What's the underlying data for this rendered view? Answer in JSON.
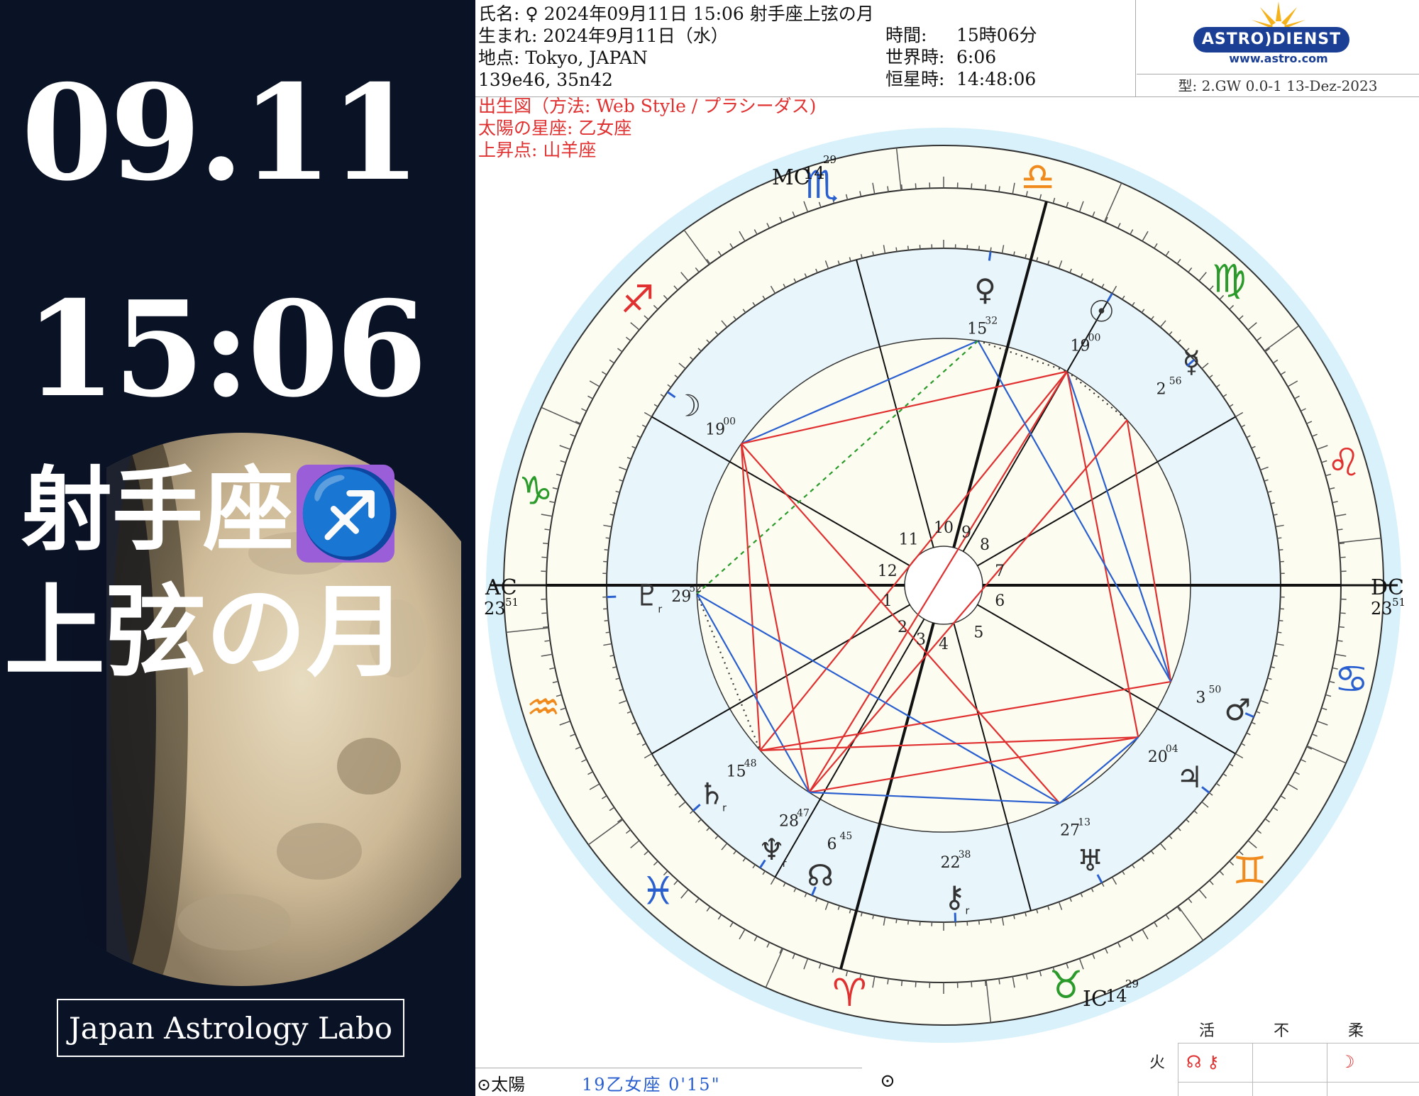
{
  "left_panel": {
    "date": "09.11",
    "time": "15:06",
    "sign_text": "射手座",
    "sign_emoji": "♐",
    "phase_text": "上弦の月",
    "brand": "Japan Astrology Labo"
  },
  "header": {
    "name_line": "氏名: ♀ 2024年09月11日 15:06 射手座上弦の月",
    "birth_line": "生まれ: 2024年9月11日（水）",
    "place_line": "地点:  Tokyo, JAPAN",
    "coords_line": "139e46, 35n42",
    "time_label": "時間:",
    "time_value": "15時06分",
    "ut_label": "世界時:",
    "ut_value": "6:06",
    "st_label": "恒星時:",
    "st_value": "14:48:06",
    "logo_text": "ASTRO)DIENST",
    "logo_url": "www.astro.com",
    "model_text": "型: 2.GW   0.0-1   13-Dez-2023"
  },
  "chart_info": {
    "method_line": "出生図（方法: Web Style / プラシーダス)",
    "sun_sign_line": "太陽の星座: 乙女座",
    "asc_line": "上昇点: 山羊座"
  },
  "wheel": {
    "angles": {
      "ac": "AC",
      "ac_deg": "23",
      "ac_min": "51",
      "dc": "DC",
      "dc_deg": "23",
      "dc_min": "51",
      "mc": "MC",
      "mc_deg": "14",
      "mc_min": "29",
      "ic": "IC",
      "ic_deg": "14",
      "ic_min": "29"
    },
    "houses": [
      "1",
      "2",
      "3",
      "4",
      "5",
      "6",
      "7",
      "8",
      "9",
      "10",
      "11",
      "12"
    ],
    "signs": [
      {
        "glyph": "♎",
        "name": "libra",
        "color": "#f08a1c"
      },
      {
        "glyph": "♍",
        "name": "virgo",
        "color": "#2a9a2a"
      },
      {
        "glyph": "♌",
        "name": "leo",
        "color": "#e03030"
      },
      {
        "glyph": "♋",
        "name": "cancer",
        "color": "#2a5fd0"
      },
      {
        "glyph": "♊",
        "name": "gemini",
        "color": "#f08a1c"
      },
      {
        "glyph": "♉",
        "name": "taurus",
        "color": "#2a9a2a"
      },
      {
        "glyph": "♈",
        "name": "aries",
        "color": "#e03030"
      },
      {
        "glyph": "♓",
        "name": "pisces",
        "color": "#2a5fd0"
      },
      {
        "glyph": "♒",
        "name": "aquarius",
        "color": "#f08a1c"
      },
      {
        "glyph": "♑",
        "name": "capricorn",
        "color": "#2a9a2a"
      },
      {
        "glyph": "♐",
        "name": "sagittarius",
        "color": "#e03030"
      },
      {
        "glyph": "♏",
        "name": "scorpio",
        "color": "#2a5fd0"
      }
    ],
    "planets": [
      {
        "name": "venus",
        "glyph": "♀",
        "deg": "15",
        "min": "32"
      },
      {
        "name": "sun",
        "glyph": "☉",
        "deg": "19",
        "min": "00"
      },
      {
        "name": "mercury",
        "glyph": "☿",
        "deg": "2",
        "min": "56"
      },
      {
        "name": "moon",
        "glyph": "☽",
        "deg": "19",
        "min": "00"
      },
      {
        "name": "pluto",
        "glyph": "♇",
        "deg": "29",
        "min": "52",
        "retro": "r"
      },
      {
        "name": "mars",
        "glyph": "♂",
        "deg": "3",
        "min": "50"
      },
      {
        "name": "jupiter",
        "glyph": "♃",
        "deg": "20",
        "min": "04"
      },
      {
        "name": "uranus",
        "glyph": "♅",
        "deg": "27",
        "min": "13"
      },
      {
        "name": "chiron",
        "glyph": "⚷",
        "deg": "22",
        "min": "38",
        "retro": "r"
      },
      {
        "name": "node",
        "glyph": "☊",
        "deg": "6",
        "min": "45"
      },
      {
        "name": "neptune",
        "glyph": "♆",
        "deg": "28",
        "min": "47",
        "retro": "r"
      },
      {
        "name": "saturn",
        "glyph": "♄",
        "deg": "15",
        "min": "48",
        "retro": "r"
      }
    ]
  },
  "bottom": {
    "planet_label": "⊙太陽",
    "planet_value": "19乙女座  0'15\"",
    "symbol": "⊙"
  },
  "elements_table": {
    "headers": [
      "活",
      "不",
      "柔"
    ],
    "row_label": "火",
    "cell1": "☊ ⚷",
    "cell3": "☽"
  },
  "colors": {
    "aspect_red": "#e03030",
    "aspect_blue": "#2a5fd0",
    "aspect_green": "#2a9a2a",
    "wheel_outer": "#d8f1fb",
    "wheel_cream": "#fdfcf0"
  }
}
